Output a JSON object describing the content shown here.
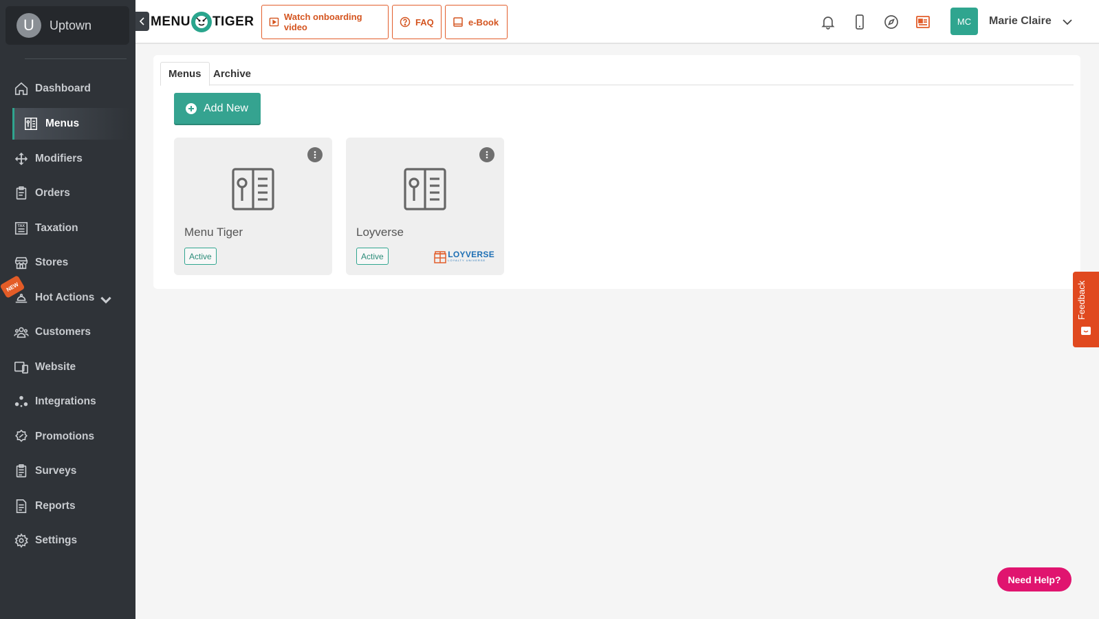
{
  "store": {
    "initial": "U",
    "name": "Uptown"
  },
  "sidebar": {
    "items": [
      {
        "label": "Dashboard",
        "icon": "home-icon"
      },
      {
        "label": "Menus",
        "icon": "menu-book-icon",
        "active": true
      },
      {
        "label": "Modifiers",
        "icon": "move-arrows-icon"
      },
      {
        "label": "Orders",
        "icon": "clipboard-icon"
      },
      {
        "label": "Taxation",
        "icon": "tax-icon"
      },
      {
        "label": "Stores",
        "icon": "store-icon"
      },
      {
        "label": "Hot Actions",
        "icon": "bell-hand-icon",
        "badge": "NEW"
      },
      {
        "label": "Customers",
        "icon": "users-icon"
      },
      {
        "label": "Website",
        "icon": "devices-icon"
      },
      {
        "label": "Integrations",
        "icon": "integrations-icon"
      },
      {
        "label": "Promotions",
        "icon": "promo-icon"
      },
      {
        "label": "Surveys",
        "icon": "survey-icon"
      },
      {
        "label": "Reports",
        "icon": "report-icon"
      },
      {
        "label": "Settings",
        "icon": "gear-icon"
      }
    ]
  },
  "header": {
    "logo_left": "MENU",
    "logo_right": "TIGER",
    "buttons": {
      "onboarding": "Watch onboarding video",
      "faq": "FAQ",
      "ebook": "e-Book"
    },
    "user": {
      "initials": "MC",
      "name": "Marie Claire"
    }
  },
  "main": {
    "tabs": [
      "Menus",
      "Archive"
    ],
    "add_button": "Add New",
    "cards": [
      {
        "title": "Menu Tiger",
        "status": "Active"
      },
      {
        "title": "Loyverse",
        "status": "Active",
        "brand": "LOYVERSE",
        "brand_sub": "LOYALTY UNIVERSE"
      }
    ]
  },
  "feedback": "Feedback",
  "help": "Need Help?",
  "colors": {
    "accent": "#35a390",
    "sidebar": "#2f3338",
    "orange": "#e25d2a",
    "help": "#e0146f"
  }
}
